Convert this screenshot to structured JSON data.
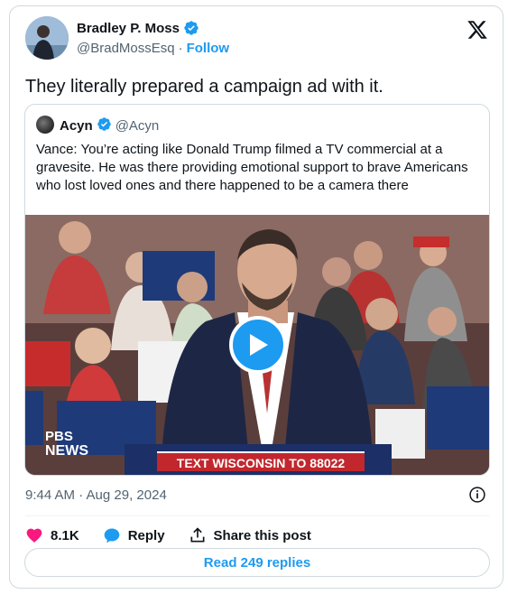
{
  "author": {
    "name": "Bradley P. Moss",
    "handle": "@BradMossEsq",
    "separator": "·",
    "follow_label": "Follow"
  },
  "tweet": {
    "text": "They literally prepared a campaign ad with it."
  },
  "quoted": {
    "name": "Acyn",
    "handle": "@Acyn",
    "text": "Vance: You’re acting like Donald Trump filmed a TV commercial at a gravesite. He was there providing emotional support to brave Americans who lost loved ones and there happened to be a camera there",
    "video": {
      "pbs_top": "PBS",
      "pbs_bottom": "NEWS",
      "banner_text": "TEXT WISCONSIN TO 88022"
    }
  },
  "meta": {
    "timestamp": "9:44 AM · Aug 29, 2024"
  },
  "actions": {
    "likes": "8.1K",
    "reply_label": "Reply",
    "share_label": "Share this post"
  },
  "read_replies_label": "Read 249 replies",
  "colors": {
    "accent": "#1d9bf0",
    "like": "#f91880",
    "text": "#0f1419",
    "secondary": "#536471",
    "border": "#cfd9de"
  },
  "icons": [
    "verified-badge-icon",
    "x-logo-icon",
    "play-icon",
    "info-icon",
    "heart-icon",
    "reply-icon",
    "share-icon"
  ]
}
